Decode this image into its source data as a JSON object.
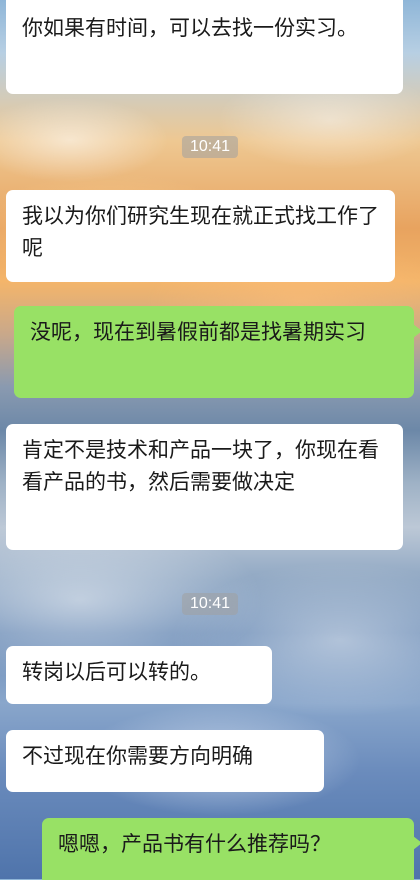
{
  "messages": [
    {
      "side": "left",
      "text": "你如果有时间，可以去找一份实习。"
    },
    {
      "type": "time",
      "text": "10:41"
    },
    {
      "side": "left",
      "text": "我以为你们研究生现在就正式找工作了呢"
    },
    {
      "side": "right",
      "text": "没呢，现在到暑假前都是找暑期实习"
    },
    {
      "side": "left",
      "text": "肯定不是技术和产品一块了，你现在看看产品的书，然后需要做决定"
    },
    {
      "type": "time",
      "text": "10:41"
    },
    {
      "side": "left",
      "text": "转岗以后可以转的。"
    },
    {
      "side": "left",
      "text": "不过现在你需要方向明确"
    },
    {
      "side": "right",
      "text": "嗯嗯，产品书有什么推荐吗？"
    }
  ]
}
